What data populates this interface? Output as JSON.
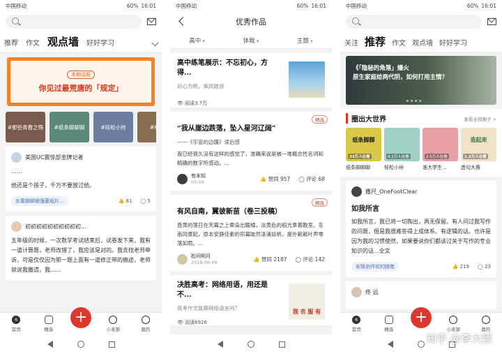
{
  "status": {
    "carrier": "中国移动",
    "battery": "60%",
    "time": "16:01"
  },
  "screen1": {
    "tabs": [
      "推荐",
      "作文",
      "观点墙",
      "好好学习"
    ],
    "active_tab": "观点墙",
    "banner": {
      "tag": "本期话题",
      "title": "你见过最荒唐的「规定」"
    },
    "circles": [
      "#那些青春之殇",
      "#纸条脚脚脚",
      "#轻松小卅",
      "#社会"
    ],
    "post1": {
      "author": "美国UC震惊部金牌记者",
      "dots": "……",
      "text": "他还是个孩子，千万不要放过他。",
      "chip": "女童脚脚被强塞纸片...",
      "likes": "81",
      "comments": "5"
    },
    "post2": {
      "author": "初初初初初初初初初初...",
      "text": "五年级的时候，一次数学考试结束后，试卷发下来，我有一道计算题，老师改错了，我应该是对的。我去找老师申诉，可是仅仅因为那一题上面有一道修正带的痕迹，老师就说我撤谎，我......"
    },
    "nav": [
      "首页",
      "精选",
      "",
      "小卖部",
      "我的"
    ]
  },
  "screen2": {
    "title": "优秀作品",
    "filters": [
      "高中",
      "体裁",
      "主题"
    ],
    "badge": "精选",
    "a1": {
      "title": "高中练笔展示：不忘初心，方得...",
      "sub": "初心为帆，乘风破浪",
      "reads": "阅读3.7万"
    },
    "a2": {
      "title": "“我从崖边跌落，坠入星河辽阔”",
      "sub": "——《宇宙的边疆》读后感",
      "excerpt": "我已经很久没有这样的感觉了，准确来说是被一堆概念性名词和精确的数字所感动。...",
      "author": "有末知",
      "date": "05-09",
      "likes": "赞同 957",
      "comments": "评论 68"
    },
    "a3": {
      "title": "有风自南，翼彼新苗（卷三投稿）",
      "excerpt": "昏黄的落日在天幕之上晕染出暖橘，淡黄色的稻光拿着教室。东南风骤起，原本安静佳素的帘幕陡然涤涌如帆，瘦外簌簌叶声零落如雨。...",
      "author": "松间明月",
      "date": "2019-06-09",
      "likes": "赞同 2187",
      "comments": "评论 142"
    },
    "a4": {
      "title": "决胜高考：网络用语，用还是不...",
      "sub": "高考作文能赛网络语言吗？",
      "reads": "阅读6926",
      "thumb_text": "我 衣 服 有"
    }
  },
  "screen3": {
    "tabs": [
      "关注",
      "推荐",
      "作文",
      "观点墙",
      "好好学习"
    ],
    "active_tab": "推荐",
    "hero": {
      "line1": "《「隐秘的角落」爆火",
      "line2": "原生家庭给两代阴，如何打用主情？"
    },
    "section": {
      "title": "圈出大世界",
      "more": "查看全部圈子 >"
    },
    "circles": [
      {
        "name": "纸条脚脚脚",
        "count": "33万人在看",
        "img_text": "纸条脚脚"
      },
      {
        "name": "轻松小卅",
        "count": "4.2万人在看",
        "img_text": ""
      },
      {
        "name": "准大学生...",
        "count": "2.5万人在看",
        "img_text": ""
      },
      {
        "name": "造句大赛",
        "count": "1.3万人在看",
        "img_text": "造起来"
      }
    ],
    "post": {
      "author": "撒尺_OneFootClear",
      "title": "如我所言",
      "text": "如我所言，我已将一切掏出，再无保留。有人问过我写作的问题，但是我很难答得上成体系、有逻辑的话。也许是因为我的习惯使然，如果要说你们都该过关于写作的专业知识的话...全文",
      "chip": "安致创作欢的随笔",
      "likes": "219",
      "comments": "23"
    },
    "post2_author": "佟 远",
    "watermark": "知乎 @李大颖"
  },
  "colors": {
    "accent": "#e0372c",
    "banner": "#f6822a"
  }
}
